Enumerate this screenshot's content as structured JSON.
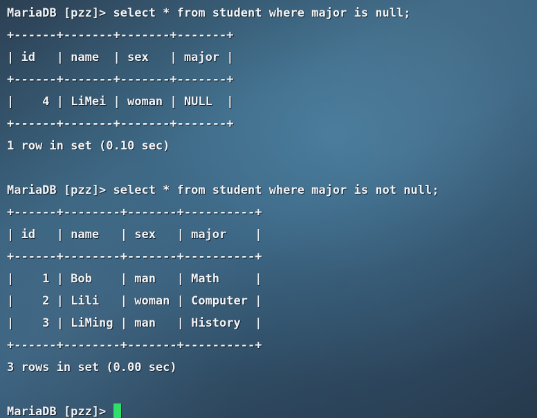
{
  "terminal": {
    "prompt": "MariaDB [pzz]> ",
    "cursor_color": "#2ee06a",
    "background_color": "#3a6380",
    "text_color": "#f2f4f6",
    "database": "pzz"
  },
  "session": {
    "lines": [
      "MariaDB [pzz]> select * from student where major is null;",
      "+------+-------+-------+-------+",
      "| id   | name  | sex   | major |",
      "+------+-------+-------+-------+",
      "|    4 | LiMei | woman | NULL  |",
      "+------+-------+-------+-------+",
      "1 row in set (0.10 sec)",
      "",
      "MariaDB [pzz]> select * from student where major is not null;",
      "+------+--------+-------+----------+",
      "| id   | name   | sex   | major    |",
      "+------+--------+-------+----------+",
      "|    1 | Bob    | man   | Math     |",
      "|    2 | Lili   | woman | Computer |",
      "|    3 | LiMing | man   | History  |",
      "+------+--------+-------+----------+",
      "3 rows in set (0.00 sec)",
      ""
    ],
    "final_prompt": "MariaDB [pzz]> "
  },
  "queries": [
    {
      "command": "select * from student where major is null;",
      "columns": [
        "id",
        "name",
        "sex",
        "major"
      ],
      "rows": [
        [
          "4",
          "LiMei",
          "woman",
          "NULL"
        ]
      ],
      "status": "1 row in set (0.10 sec)",
      "row_count": 1,
      "duration_sec": "0.10"
    },
    {
      "command": "select * from student where major is not null;",
      "columns": [
        "id",
        "name",
        "sex",
        "major"
      ],
      "rows": [
        [
          "1",
          "Bob",
          "man",
          "Math"
        ],
        [
          "2",
          "Lili",
          "woman",
          "Computer"
        ],
        [
          "3",
          "LiMing",
          "man",
          "History"
        ]
      ],
      "status": "3 rows in set (0.00 sec)",
      "row_count": 3,
      "duration_sec": "0.00"
    }
  ]
}
